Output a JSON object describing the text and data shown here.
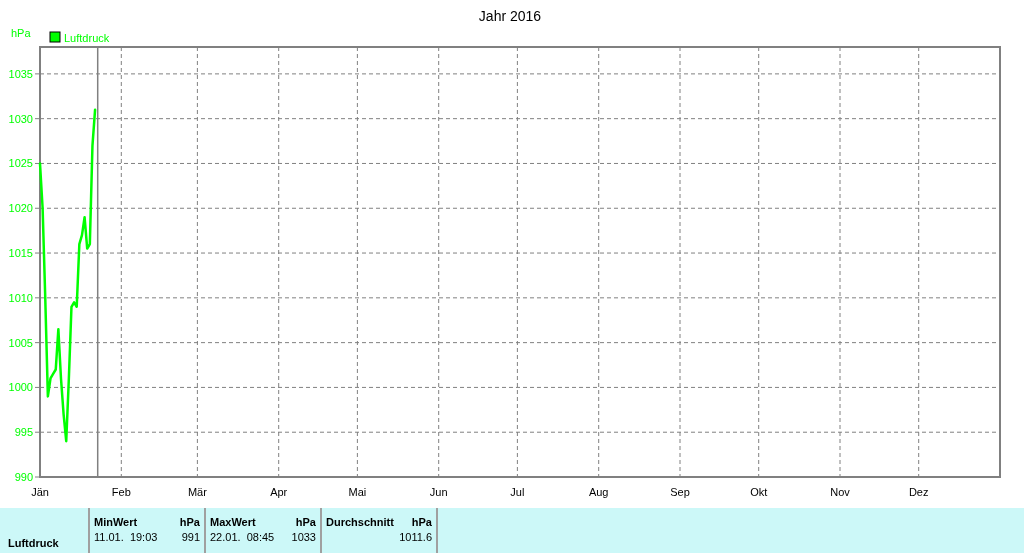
{
  "chart": {
    "chart_data": {
      "type": "line",
      "title": "Jahr 2016",
      "ylabel": "hPa",
      "grid": true,
      "ylim": [
        990,
        1038
      ],
      "yticks": [
        990,
        995,
        1000,
        1005,
        1010,
        1015,
        1020,
        1025,
        1030,
        1035
      ],
      "categories": [
        "Jän",
        null,
        null,
        null,
        null,
        null,
        null,
        null,
        null,
        null,
        null,
        null,
        null,
        null,
        null,
        null,
        null,
        null,
        null,
        null,
        null,
        null,
        null,
        null,
        null,
        null,
        null,
        null,
        null,
        null,
        null,
        "Feb",
        null,
        null,
        null,
        null,
        null,
        null,
        null,
        null,
        null,
        null,
        null,
        null,
        null,
        null,
        null,
        null,
        null,
        null,
        null,
        null,
        null,
        null,
        null,
        null,
        null,
        null,
        null,
        null,
        "Mär",
        null,
        null,
        null,
        null,
        null,
        null,
        null,
        null,
        null,
        null,
        null,
        null,
        null,
        null,
        null,
        null,
        null,
        null,
        null,
        null,
        null,
        null,
        null,
        null,
        null,
        null,
        null,
        null,
        null,
        null,
        "Apr",
        null,
        null,
        null,
        null,
        null,
        null,
        null,
        null,
        null,
        null,
        null,
        null,
        null,
        null,
        null,
        null,
        null,
        null,
        null,
        null,
        null,
        null,
        null,
        null,
        null,
        null,
        null,
        null,
        null,
        "Mai",
        null,
        null,
        null,
        null,
        null,
        null,
        null,
        null,
        null,
        null,
        null,
        null,
        null,
        null,
        null,
        null,
        null,
        null,
        null,
        null,
        null,
        null,
        null,
        null,
        null,
        null,
        null,
        null,
        null,
        null,
        "Jun",
        null,
        null,
        null,
        null,
        null,
        null,
        null,
        null,
        null,
        null,
        null,
        null,
        null,
        null,
        null,
        null,
        null,
        null,
        null,
        null,
        null,
        null,
        null,
        null,
        null,
        null,
        null,
        null,
        null,
        "Jul",
        null,
        null,
        null,
        null,
        null,
        null,
        null,
        null,
        null,
        null,
        null,
        null,
        null,
        null,
        null,
        null,
        null,
        null,
        null,
        null,
        null,
        null,
        null,
        null,
        null,
        null,
        null,
        null,
        null,
        null,
        "Aug",
        null,
        null,
        null,
        null,
        null,
        null,
        null,
        null,
        null,
        null,
        null,
        null,
        null,
        null,
        null,
        null,
        null,
        null,
        null,
        null,
        null,
        null,
        null,
        null,
        null,
        null,
        null,
        null,
        null,
        null,
        "Sep",
        null,
        null,
        null,
        null,
        null,
        null,
        null,
        null,
        null,
        null,
        null,
        null,
        null,
        null,
        null,
        null,
        null,
        null,
        null,
        null,
        null,
        null,
        null,
        null,
        null,
        null,
        null,
        null,
        null,
        "Okt",
        null,
        null,
        null,
        null,
        null,
        null,
        null,
        null,
        null,
        null,
        null,
        null,
        null,
        null,
        null,
        null,
        null,
        null,
        null,
        null,
        null,
        null,
        null,
        null,
        null,
        null,
        null,
        null,
        null,
        null,
        "Nov",
        null,
        null,
        null,
        null,
        null,
        null,
        null,
        null,
        null,
        null,
        null,
        null,
        null,
        null,
        null,
        null,
        null,
        null,
        null,
        null,
        null,
        null,
        null,
        null,
        null,
        null,
        null,
        null,
        null,
        "Dez",
        null,
        null,
        null,
        null,
        null,
        null,
        null,
        null,
        null,
        null,
        null,
        null,
        null,
        null,
        null,
        null,
        null,
        null,
        null,
        null,
        null,
        null,
        null,
        null,
        null,
        null,
        null,
        null,
        null,
        null
      ],
      "series": [
        {
          "name": "Luftdruck",
          "color": "#00ff00",
          "values": [
            1025,
            1020,
            1010,
            999,
            1001,
            1001.5,
            1002,
            1006.5,
            1001,
            997,
            994,
            1001,
            1009,
            1009.5,
            1009,
            1016,
            1017,
            1019,
            1015.5,
            1016,
            1027,
            1031,
            null,
            null,
            null,
            null,
            null,
            null,
            null,
            null,
            null,
            null,
            null,
            null,
            null,
            null,
            null,
            null,
            null,
            null,
            null,
            null,
            null,
            null,
            null,
            null,
            null,
            null,
            null,
            null,
            null,
            null,
            null,
            null,
            null,
            null,
            null,
            null,
            null,
            null,
            null,
            null,
            null,
            null,
            null,
            null,
            null,
            null,
            null,
            null,
            null,
            null,
            null,
            null,
            null,
            null,
            null,
            null,
            null,
            null,
            null,
            null,
            null,
            null,
            null,
            null,
            null,
            null,
            null,
            null,
            null,
            null,
            null,
            null,
            null,
            null,
            null,
            null,
            null,
            null,
            null,
            null,
            null,
            null,
            null,
            null,
            null,
            null,
            null,
            null,
            null,
            null,
            null,
            null,
            null,
            null,
            null,
            null,
            null,
            null,
            null,
            null,
            null,
            null,
            null,
            null,
            null,
            null,
            null,
            null,
            null,
            null,
            null,
            null,
            null,
            null,
            null,
            null,
            null,
            null,
            null,
            null,
            null,
            null,
            null,
            null,
            null,
            null,
            null,
            null,
            null,
            null,
            null,
            null,
            null,
            null,
            null,
            null,
            null,
            null,
            null,
            null,
            null,
            null,
            null,
            null,
            null,
            null,
            null,
            null,
            null,
            null,
            null,
            null,
            null,
            null,
            null,
            null,
            null,
            null,
            null,
            null,
            null,
            null,
            null,
            null,
            null,
            null,
            null,
            null,
            null,
            null,
            null,
            null,
            null,
            null,
            null,
            null,
            null,
            null,
            null,
            null,
            null,
            null,
            null,
            null,
            null,
            null,
            null,
            null,
            null,
            null,
            null,
            null,
            null,
            null,
            null,
            null,
            null,
            null,
            null,
            null,
            null,
            null,
            null,
            null,
            null,
            null,
            null,
            null,
            null,
            null,
            null,
            null,
            null,
            null,
            null,
            null,
            null,
            null,
            null,
            null,
            null,
            null,
            null,
            null,
            null,
            null,
            null,
            null,
            null,
            null,
            null,
            null,
            null,
            null,
            null,
            null,
            null,
            null,
            null,
            null,
            null,
            null,
            null,
            null,
            null,
            null,
            null,
            null,
            null,
            null,
            null,
            null,
            null,
            null,
            null,
            null,
            null,
            null,
            null,
            null,
            null,
            null,
            null,
            null,
            null,
            null,
            null,
            null,
            null,
            null,
            null,
            null,
            null,
            null,
            null,
            null,
            null,
            null,
            null,
            null,
            null,
            null,
            null,
            null,
            null,
            null,
            null,
            null,
            null,
            null,
            null,
            null,
            null,
            null,
            null,
            null,
            null,
            null,
            null,
            null,
            null,
            null,
            null,
            null,
            null,
            null,
            null,
            null,
            null,
            null,
            null,
            null,
            null,
            null,
            null,
            null,
            null,
            null,
            null,
            null,
            null,
            null,
            null,
            null,
            null,
            null,
            null,
            null,
            null,
            null,
            null,
            null,
            null,
            null,
            null,
            null,
            null,
            null,
            null,
            null,
            null,
            null,
            null,
            null
          ]
        }
      ]
    }
  },
  "stats": {
    "row_label": "Luftdruck",
    "columns": [
      {
        "heading": "MinWert",
        "unit": "hPa",
        "time": "11.01.  19:03",
        "value": "991"
      },
      {
        "heading": "MaxWert",
        "unit": "hPa",
        "time": "22.01.  08:45",
        "value": "1033"
      },
      {
        "heading": "Durchschnitt",
        "unit": "hPa",
        "value": "1011.6"
      }
    ]
  }
}
